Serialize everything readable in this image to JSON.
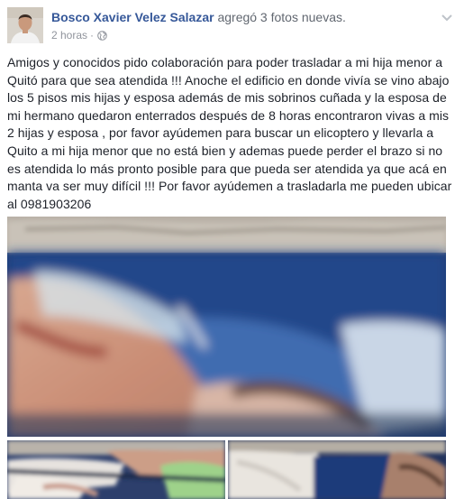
{
  "post": {
    "author": "Bosco Xavier Velez Salazar",
    "action": "agregó 3 fotos nuevas.",
    "time": "2 horas",
    "meta_separator": "·",
    "audience_icon": "globe-icon",
    "menu_icon": "chevron-down-icon",
    "text": "Amigos y conocidos pido colaboración para poder trasladar a mi hija menor a Quitó para que sea atendida !!! Anoche el edificio en donde vivía se vino abajo los 5 pisos mis hijas y esposa además de mis sobrinos cuñada y la esposa de mi hermano quedaron enterrados después de 8 horas encontraron vivas a mis 2 hijas y esposa , por favor ayúdemen para buscar un elicoptero y llevarla a Quito a mi hija menor que no está bien y ademas puede perder el brazo si no es atendida lo más pronto posible para que pueda ser atendida ya que acá en manta va ser muy difícil !!! Por favor ayúdemen a trasladarla me pueden ubicar al 0981903206"
  },
  "colors": {
    "link": "#365899",
    "meta": "#90949c",
    "body_text": "#1d2129"
  }
}
